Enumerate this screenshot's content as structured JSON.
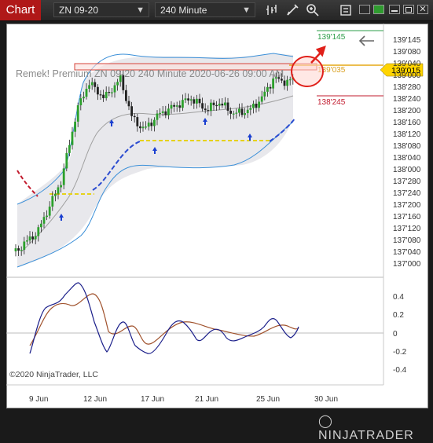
{
  "toolbar": {
    "title": "Chart",
    "instrument": "ZN 09-20",
    "interval": "240 Minute"
  },
  "icons": [
    "bar-chart-icon",
    "pencil-icon",
    "zoom-icon",
    "properties-icon",
    "window-color-icons",
    "window-controls"
  ],
  "colors": {
    "title_bg": "#b01818",
    "up_candle": "#2ca02c",
    "band_line": "#3a8fd8",
    "highlight_line": "#e6a817",
    "stop_line": "#c21b2e",
    "target_line": "#2e9e4a"
  },
  "chart_data": {
    "type": "candlestick",
    "title": "Remek!  Premium  ZN 09-20  240 Minute  2020-06-26 09:00 AM",
    "copyright": "©2020 NinjaTrader, LLC",
    "logo": "NINJATRADER",
    "y_axis_labels": [
      "139'145",
      "139'080",
      "139'040",
      "139'000",
      "138'280",
      "138'240",
      "138'200",
      "138'160",
      "138'120",
      "138'080",
      "138'040",
      "138'000",
      "137'280",
      "137'240",
      "137'200",
      "137'160",
      "137'120",
      "137'080",
      "137'040",
      "137'000"
    ],
    "x_axis_labels": [
      "9 Jun",
      "12 Jun",
      "17 Jun",
      "21 Jun",
      "25 Jun",
      "30 Jun"
    ],
    "price_levels": {
      "target": "139'145",
      "entry": "139'035",
      "current": "139'015",
      "stop": "138'245"
    },
    "oscillator": {
      "y_axis_labels": [
        "0.4",
        "0.2",
        "0",
        "-0.2",
        "-0.4"
      ],
      "ylim": [
        -0.45,
        0.5
      ]
    }
  }
}
